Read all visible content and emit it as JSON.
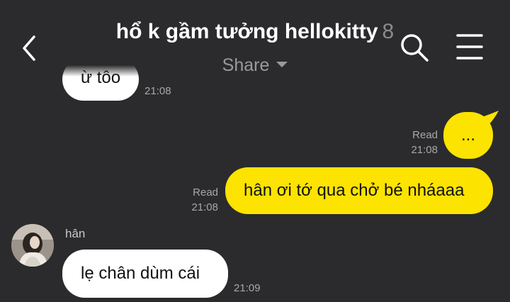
{
  "header": {
    "title": "hổ k gầm tưởng hellokitty",
    "member_count": "8",
    "subtitle": "Share"
  },
  "messages": [
    {
      "text": "ừ tôo",
      "time": "21:08",
      "direction": "incoming"
    },
    {
      "text": "...",
      "read": "Read",
      "time": "21:08",
      "direction": "outgoing"
    },
    {
      "text": "hân ơi tớ qua chở bé nháaaa",
      "read": "Read",
      "time": "21:08",
      "direction": "outgoing"
    },
    {
      "sender": "hân",
      "text": "lẹ chân dùm cái",
      "time": "21:09",
      "direction": "incoming"
    }
  ],
  "colors": {
    "background": "#2b2b2d",
    "outgoing_bubble": "#fce300",
    "incoming_bubble": "#ffffff"
  },
  "icons": {
    "back": "chevron-left-icon",
    "search": "search-icon",
    "menu": "hamburger-menu-icon"
  }
}
